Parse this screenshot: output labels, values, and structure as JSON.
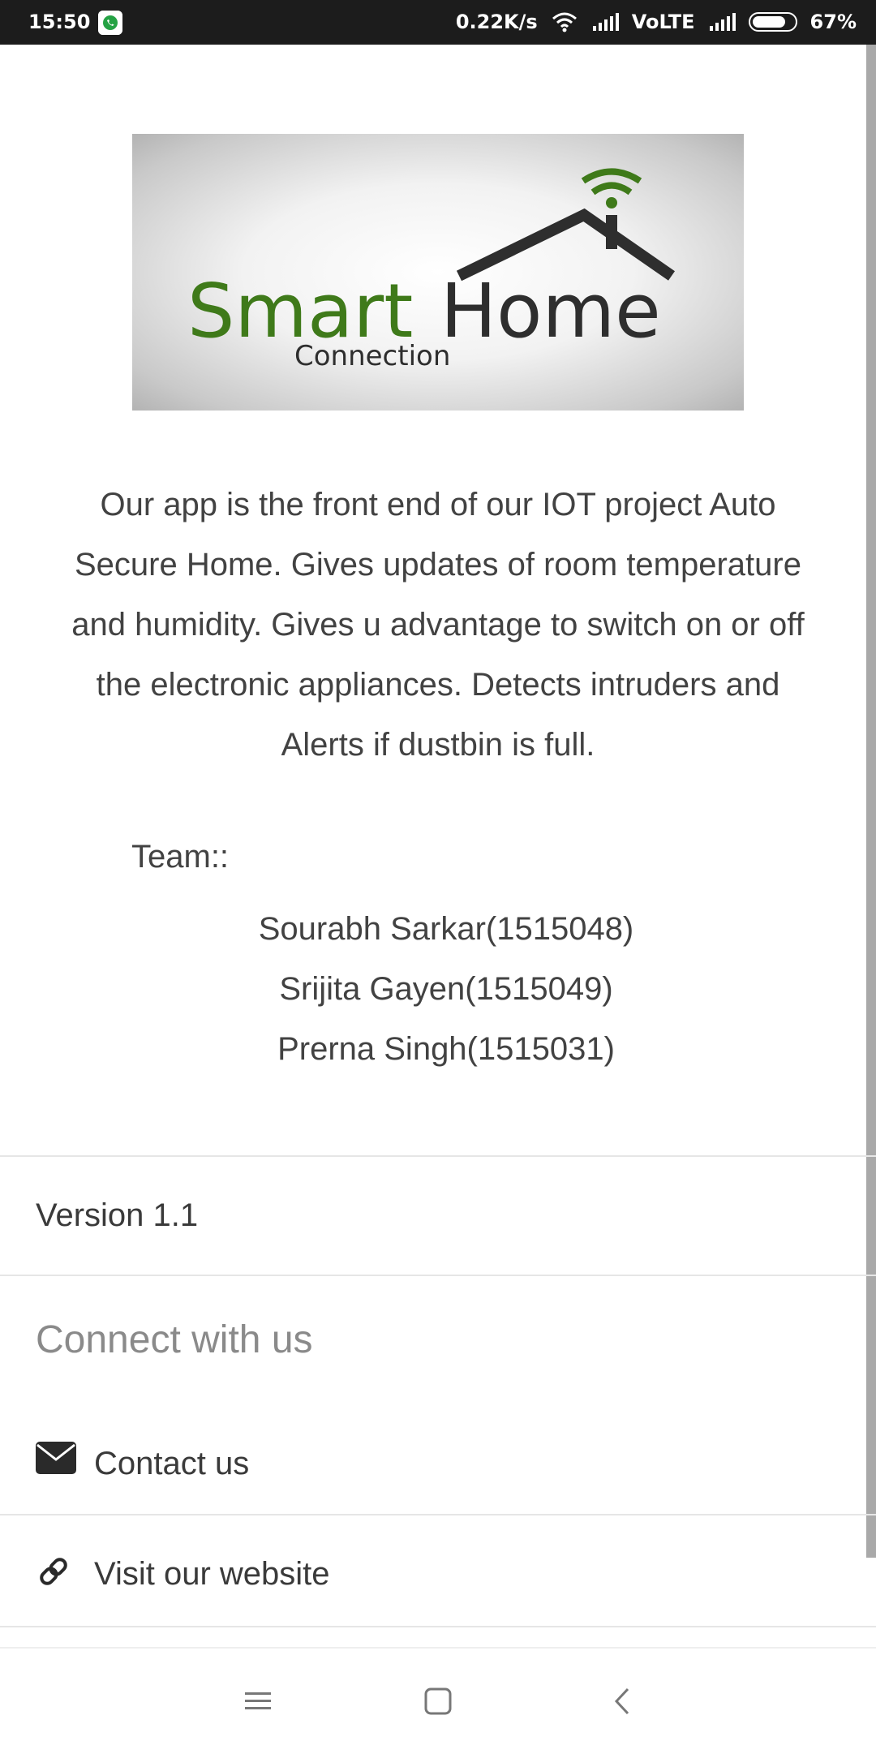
{
  "status_bar": {
    "time": "15:50",
    "network_speed": "0.22K/s",
    "network_type": "VoLTE",
    "battery": "67%"
  },
  "logo": {
    "smart": "Smart",
    "home": "Home",
    "connection": "Connection",
    "colors": {
      "smart": "#3f7a1a",
      "home": "#2e2e2e"
    }
  },
  "about": {
    "description": "Our app is the front end of our IOT project Auto Secure Home. Gives updates of room temperature and humidity. Gives u advantage to switch on or off the electronic appliances. Detects intruders and Alerts if dustbin is full.",
    "team_label": "Team::",
    "team": [
      "Sourabh Sarkar(1515048)",
      "Srijita Gayen(1515049)",
      "Prerna Singh(1515031)"
    ]
  },
  "version": "Version 1.1",
  "connect": {
    "title": "Connect with us",
    "items": [
      {
        "label": "Contact us",
        "icon": "envelope-icon"
      },
      {
        "label": "Visit our website",
        "icon": "link-icon"
      }
    ]
  },
  "nav": {
    "icons": [
      "menu-icon",
      "home-square-icon",
      "back-icon"
    ]
  }
}
